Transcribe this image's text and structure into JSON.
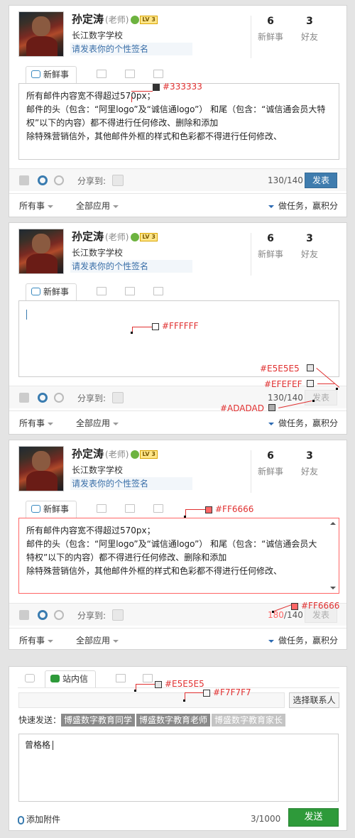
{
  "user": {
    "name": "孙定涛",
    "role": "(老师)",
    "level": "LV 3",
    "school": "长江数字学校",
    "signature_prompt": "请发表你的个性签名"
  },
  "stats": {
    "news_count": "6",
    "news_label": "新鲜事",
    "friends_count": "3",
    "friends_label": "好友"
  },
  "tabs": {
    "news": "新鲜事",
    "mail": "站内信"
  },
  "editor_text": [
    "所有邮件内容宽不得超过570px；",
    "邮件的头（包含：“阿里logo”及“诚信通logo”） 和尾（包含：“诚信通会员大特权”以下的内容）都不得进行任何修改、删除和添加",
    "除特殊营销信外，其他邮件外框的样式和色彩都不得进行任何修改、"
  ],
  "editor_text_narrow": [
    "所有邮件内容宽不得超过570px；",
    "邮件的头（包含：“阿里logo”及“诚信通logo”） 和尾（包含：“诚信通会员大特权”以下的内容）都不得进行任何修改、删除和添加",
    "除特殊营销信外，其他邮件外框的样式和色彩都不得进行任何修改、"
  ],
  "bar": {
    "share_label": "分享到:",
    "count1": "130/140",
    "count2": "130/140",
    "count3_over": "180",
    "count3_rest": "/140",
    "send": "发表"
  },
  "footer": {
    "filter_all": "所有事",
    "filter_apps": "全部应用",
    "task": "做任务，赢积分"
  },
  "annotations": {
    "a1": "#333333",
    "a2": "#FFFFFF",
    "a3": "#E5E5E5",
    "a4": "#EFEFEF",
    "a5": "#ADADAD",
    "a6": "#FF6666",
    "a7": "#FF6666",
    "a8": "#E5E5E5",
    "a9": "#F7F7F7"
  },
  "mail": {
    "choose_contact": "选择联系人",
    "quick_send_label": "快速发送：",
    "quick_targets": [
      "博盛数字教育同学",
      "博盛数字教育老师",
      "博盛数字教育家长"
    ],
    "body_text": "曾格格",
    "attach": "添加附件",
    "count": "3/1000",
    "send": "发送"
  },
  "colors": {
    "primary": "#3f7cae",
    "error": "#ff6666",
    "green": "#2e9a3a",
    "border": "#e5e5e5",
    "disabled_bg": "#efefef",
    "disabled_text": "#adadad",
    "text": "#333333"
  }
}
